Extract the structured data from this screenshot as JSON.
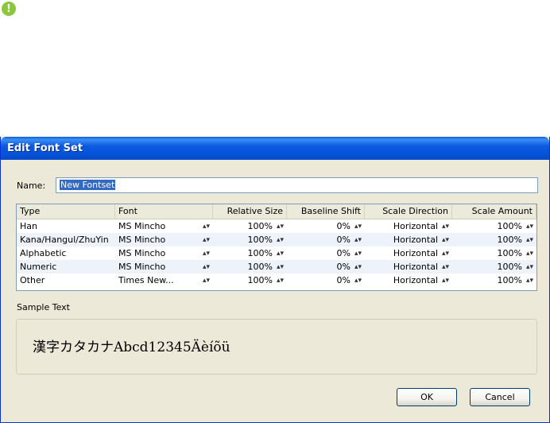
{
  "dialog": {
    "title": "Edit Font Set",
    "name_label": "Name:",
    "name_value": "New Fontset"
  },
  "grid": {
    "columns": [
      "Type",
      "Font",
      "Relative Size",
      "Baseline Shift",
      "Scale Direction",
      "Scale Amount"
    ],
    "rows": [
      {
        "type": "Han",
        "font": "MS Mincho",
        "size": "100%",
        "shift": "0%",
        "direction": "Horizontal",
        "amount": "100%"
      },
      {
        "type": "Kana/Hangul/ZhuYin",
        "font": "MS Mincho",
        "size": "100%",
        "shift": "0%",
        "direction": "Horizontal",
        "amount": "100%"
      },
      {
        "type": "Alphabetic",
        "font": "MS Mincho",
        "size": "100%",
        "shift": "0%",
        "direction": "Horizontal",
        "amount": "100%"
      },
      {
        "type": "Numeric",
        "font": "MS Mincho",
        "size": "100%",
        "shift": "0%",
        "direction": "Horizontal",
        "amount": "100%"
      },
      {
        "type": "Other",
        "font": "Times New...",
        "size": "100%",
        "shift": "0%",
        "direction": "Horizontal",
        "amount": "100%"
      }
    ]
  },
  "sample": {
    "label": "Sample Text",
    "text": "漢字カタカナAbcd12345Äèíõü"
  },
  "buttons": {
    "ok": "OK",
    "cancel": "Cancel"
  },
  "icons": {
    "tip": "exclamation-icon"
  }
}
